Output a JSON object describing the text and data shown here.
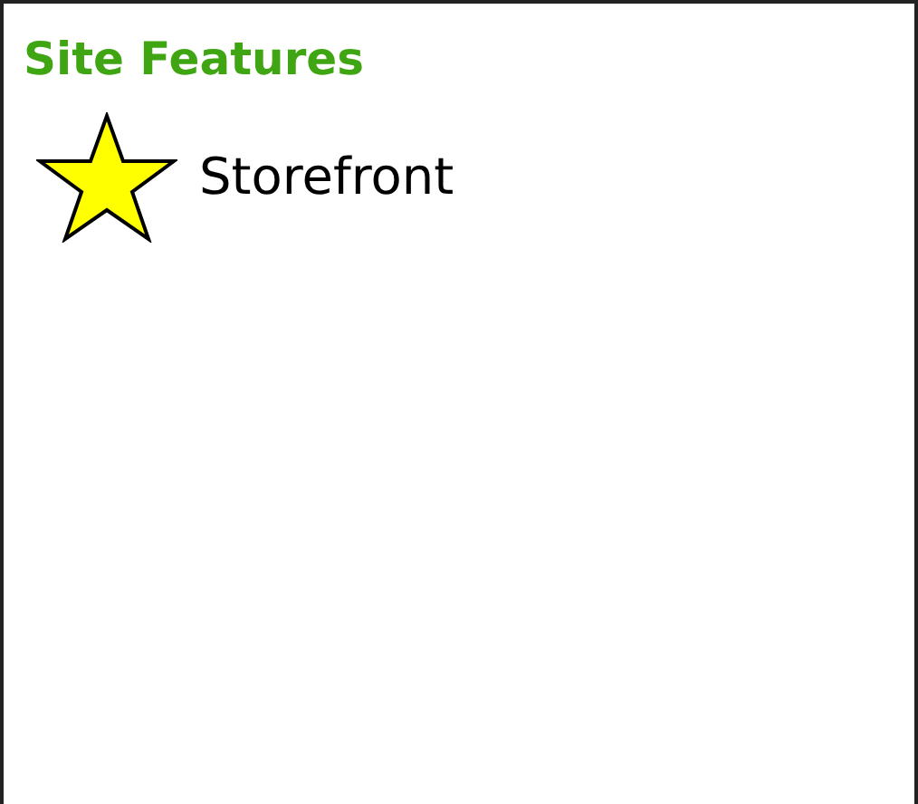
{
  "title": "Site Features",
  "features": [
    {
      "label": "Storefront"
    }
  ]
}
